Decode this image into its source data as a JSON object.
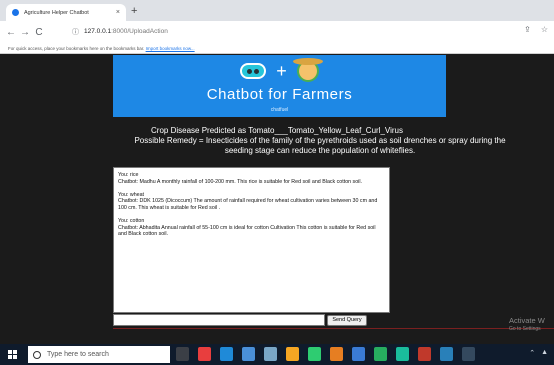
{
  "browser": {
    "tab_title": "Agriculture Helper Chatbot",
    "tab_close": "×",
    "new_tab": "+",
    "back": "←",
    "forward": "→",
    "reload": "C",
    "address_host": "127.0.0.1",
    "address_path": ":8000/UploadAction",
    "share_icon": "⇪",
    "star_icon": "☆",
    "bookmarks_text": "For quick access, place your bookmarks here on the bookmarks bar.",
    "bookmarks_link": "Import bookmarks now..."
  },
  "banner": {
    "plus": "+",
    "headline": "Chatbot for Farmers",
    "brand": "chatfuel"
  },
  "prediction": {
    "disease": "Crop Disease Predicted as Tomato___Tomato_Yellow_Leaf_Curl_Virus",
    "remedy": "Possible Remedy = Insecticides of the family of the pyrethroids used as soil drenches or spray during the seeding stage can reduce the population of whiteflies."
  },
  "chat": [
    {
      "user": "You: rice",
      "bot": "Chatbot: Madhu A monthly rainfall of 100-200 mm. This rice is suitable for Red soil and Black cotton soil."
    },
    {
      "user": "You: wheat",
      "bot": "Chatbot: DDK 1025 (Dicoccum) The amount of rainfall required for wheat cultivation varies between 30 cm and 100 cm. This wheat is suitable for Red soil ."
    },
    {
      "user": "You: cotton",
      "bot": "Chatbot: Abhadita Annual rainfall of 55-100 cm is ideal for cotton Cultivation This cotton is suitable for Red soil and Black cotton soil."
    }
  ],
  "query": {
    "value": "",
    "send_label": "Send Query"
  },
  "watermark": {
    "line1": "Activate W",
    "line2": "Go to Settings"
  },
  "taskbar": {
    "search_placeholder": "Type here to search",
    "app_colors": [
      "#3b3f46",
      "#e83e3e",
      "#1f8ad8",
      "#4a90d9",
      "#7aa7c7",
      "#f5a623",
      "#2ecc71",
      "#e67e22",
      "#3a7bd5",
      "#27ae60",
      "#1abc9c",
      "#c0392b",
      "#2980b9",
      "#34495e"
    ],
    "tray_icons": [
      "⌃",
      "▲"
    ]
  }
}
